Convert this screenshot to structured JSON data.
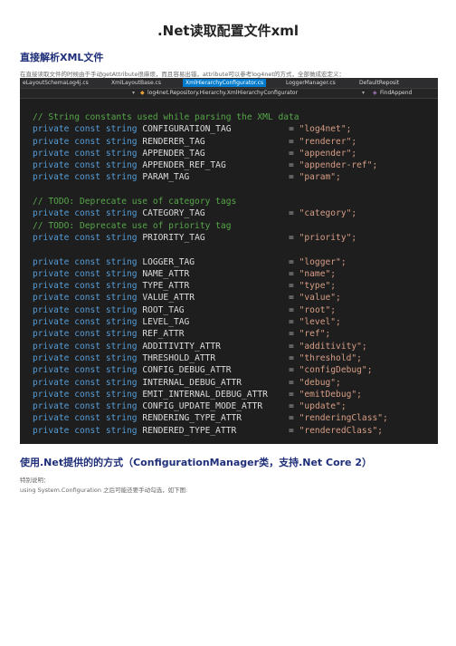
{
  "page_title": ".Net读取配置文件xml",
  "section1": {
    "heading": "直接解析XML文件",
    "note": "在直接读取文件的时候由于手动getAttribute很麻烦，而且容易出错，attribute可以参考log4net的方式，全部做成宏定义："
  },
  "ide": {
    "tabs": [
      "eLayoutSchemaLog4j.cs",
      "XmlLayoutBase.cs",
      "XmlHierarchyConfigurator.cs",
      "LoggerManager.cs",
      "DefaultReposit"
    ],
    "active_tab_index": 2,
    "nav_left": "log4net.Repository.Hierarchy.XmlHierarchyConfigurator",
    "nav_right": "FindAppend",
    "code_lines": [
      {
        "type": "comment",
        "text": "// String constants used while parsing the XML data"
      },
      {
        "type": "decl",
        "kw": "private const string",
        "name": "CONFIGURATION_TAG",
        "pad": "           ",
        "value": "\"log4net\";"
      },
      {
        "type": "decl",
        "kw": "private const string",
        "name": "RENDERER_TAG",
        "pad": "                ",
        "value": "\"renderer\";"
      },
      {
        "type": "decl",
        "kw": "private const string",
        "name": "APPENDER_TAG",
        "pad": "                ",
        "value": "\"appender\";"
      },
      {
        "type": "decl",
        "kw": "private const string",
        "name": "APPENDER_REF_TAG",
        "pad": "            ",
        "value": "\"appender-ref\";"
      },
      {
        "type": "decl",
        "kw": "private const string",
        "name": "PARAM_TAG",
        "pad": "                   ",
        "value": "\"param\";"
      },
      {
        "type": "blank"
      },
      {
        "type": "comment",
        "text": "// TODO: Deprecate use of category tags"
      },
      {
        "type": "decl",
        "kw": "private const string",
        "name": "CATEGORY_TAG",
        "pad": "                ",
        "value": "\"category\";"
      },
      {
        "type": "comment",
        "text": "// TODO: Deprecate use of priority tag"
      },
      {
        "type": "decl",
        "kw": "private const string",
        "name": "PRIORITY_TAG",
        "pad": "                ",
        "value": "\"priority\";"
      },
      {
        "type": "blank"
      },
      {
        "type": "decl",
        "kw": "private const string",
        "name": "LOGGER_TAG",
        "pad": "                  ",
        "value": "\"logger\";"
      },
      {
        "type": "decl",
        "kw": "private const string",
        "name": "NAME_ATTR",
        "pad": "                   ",
        "value": "\"name\";"
      },
      {
        "type": "decl",
        "kw": "private const string",
        "name": "TYPE_ATTR",
        "pad": "                   ",
        "value": "\"type\";"
      },
      {
        "type": "decl",
        "kw": "private const string",
        "name": "VALUE_ATTR",
        "pad": "                  ",
        "value": "\"value\";"
      },
      {
        "type": "decl",
        "kw": "private const string",
        "name": "ROOT_TAG",
        "pad": "                    ",
        "value": "\"root\";"
      },
      {
        "type": "decl",
        "kw": "private const string",
        "name": "LEVEL_TAG",
        "pad": "                   ",
        "value": "\"level\";"
      },
      {
        "type": "decl",
        "kw": "private const string",
        "name": "REF_ATTR",
        "pad": "                    ",
        "value": "\"ref\";"
      },
      {
        "type": "decl",
        "kw": "private const string",
        "name": "ADDITIVITY_ATTR",
        "pad": "             ",
        "value": "\"additivity\";"
      },
      {
        "type": "decl",
        "kw": "private const string",
        "name": "THRESHOLD_ATTR",
        "pad": "              ",
        "value": "\"threshold\";"
      },
      {
        "type": "decl",
        "kw": "private const string",
        "name": "CONFIG_DEBUG_ATTR",
        "pad": "           ",
        "value": "\"configDebug\";"
      },
      {
        "type": "decl",
        "kw": "private const string",
        "name": "INTERNAL_DEBUG_ATTR",
        "pad": "         ",
        "value": "\"debug\";"
      },
      {
        "type": "decl",
        "kw": "private const string",
        "name": "EMIT_INTERNAL_DEBUG_ATTR",
        "pad": "    ",
        "value": "\"emitDebug\";"
      },
      {
        "type": "decl",
        "kw": "private const string",
        "name": "CONFIG_UPDATE_MODE_ATTR",
        "pad": "     ",
        "value": "\"update\";"
      },
      {
        "type": "decl",
        "kw": "private const string",
        "name": "RENDERING_TYPE_ATTR",
        "pad": "         ",
        "value": "\"renderingClass\";"
      },
      {
        "type": "decl",
        "kw": "private const string",
        "name": "RENDERED_TYPE_ATTR",
        "pad": "          ",
        "value": "\"renderedClass\";"
      }
    ]
  },
  "section2": {
    "heading": "使用.Net提供的的方式（ConfigurationManager类，支持.Net Core 2）",
    "note1": "特别说明：",
    "note2": "using System.Configuration 之后可能还要手动勾选，如下图:"
  }
}
